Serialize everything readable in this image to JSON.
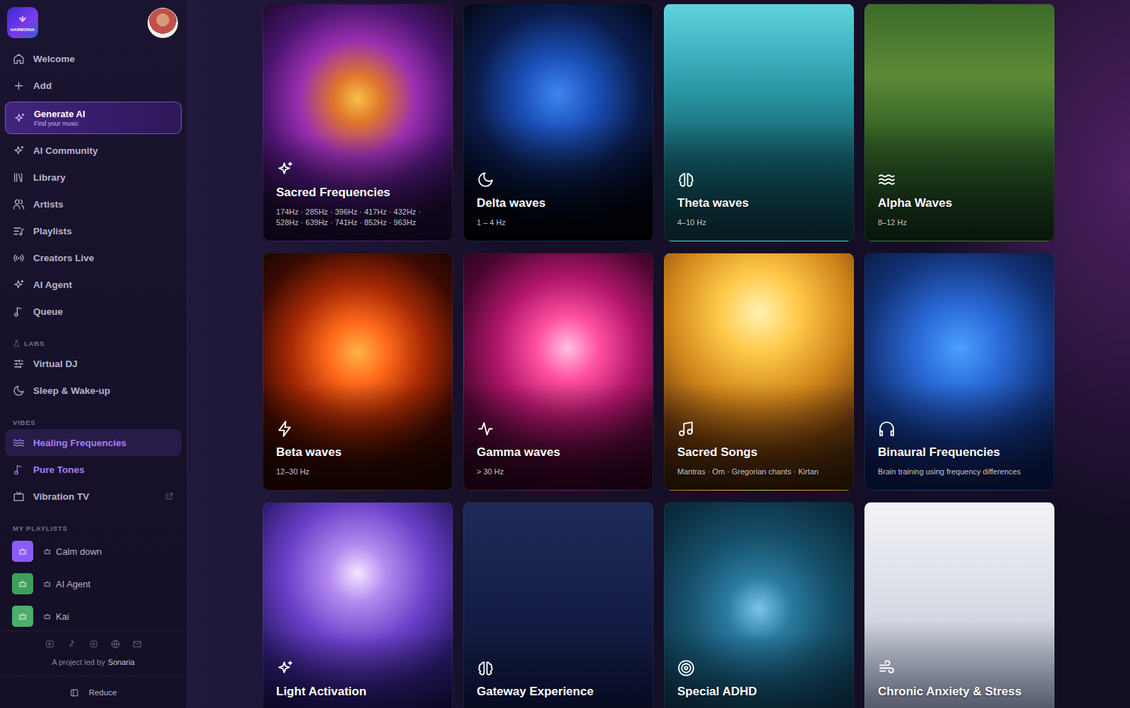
{
  "brand": {
    "logo": "HARMONIA"
  },
  "sidebar": {
    "nav": [
      {
        "label": "Welcome",
        "kind": "link",
        "selected": false
      },
      {
        "label": "Add",
        "kind": "link",
        "selected": false
      },
      {
        "label": "Generate AI",
        "sublabel": "Find your music",
        "kind": "featured",
        "selected": false
      },
      {
        "label": "AI Community",
        "kind": "link",
        "selected": false
      },
      {
        "label": "Library",
        "kind": "link",
        "selected": false
      },
      {
        "label": "Artists",
        "kind": "link",
        "selected": false
      },
      {
        "label": "Playlists",
        "kind": "link",
        "selected": false
      },
      {
        "label": "Creators Live",
        "kind": "link",
        "selected": false
      },
      {
        "label": "AI Agent",
        "kind": "link",
        "selected": false
      },
      {
        "label": "Queue",
        "kind": "link",
        "selected": false
      }
    ],
    "sections": [
      {
        "title": "LABS",
        "items": [
          {
            "label": "Virtual DJ",
            "selected": false,
            "accent": false,
            "external": false
          },
          {
            "label": "Sleep & Wake-up",
            "selected": false,
            "accent": false,
            "external": false
          }
        ]
      },
      {
        "title": "VIBES",
        "items": [
          {
            "label": "Healing Frequencies",
            "selected": true,
            "accent": true,
            "external": false
          },
          {
            "label": "Pure Tones",
            "selected": false,
            "accent": true,
            "external": false
          },
          {
            "label": "Vibration TV",
            "selected": false,
            "accent": false,
            "external": true
          }
        ]
      }
    ],
    "playlists": {
      "title": "MY PLAYLISTS",
      "items": [
        {
          "name": "Calm down",
          "color": "#8b5cf6"
        },
        {
          "name": "AI Agent",
          "color": "#3f9e5a"
        },
        {
          "name": "Kai",
          "color": "#4caf6a"
        }
      ]
    },
    "footer": {
      "credit": "A project led by",
      "author": "Sonaria",
      "collapse": "Reduce"
    }
  },
  "cards": [
    {
      "title": "Sacred Frequencies",
      "subtitle": "174Hz · 285Hz · 396Hz · 417Hz · 432Hz · 528Hz · 639Hz · 741Hz · 852Hz · 963Hz"
    },
    {
      "title": "Delta waves",
      "subtitle": "1 – 4 Hz"
    },
    {
      "title": "Theta waves",
      "subtitle": "4–10 Hz"
    },
    {
      "title": "Alpha Waves",
      "subtitle": "8–12 Hz"
    },
    {
      "title": "Beta waves",
      "subtitle": "12–30 Hz"
    },
    {
      "title": "Gamma waves",
      "subtitle": "> 30 Hz"
    },
    {
      "title": "Sacred Songs",
      "subtitle": "Mantras · Om · Gregorian chants · Kirtan"
    },
    {
      "title": "Binaural Frequencies",
      "subtitle": "Brain training using frequency differences"
    },
    {
      "title": "Light Activation"
    },
    {
      "title": "Gateway Experience"
    },
    {
      "title": "Special ADHD"
    },
    {
      "title": "Chronic Anxiety & Stress"
    }
  ]
}
